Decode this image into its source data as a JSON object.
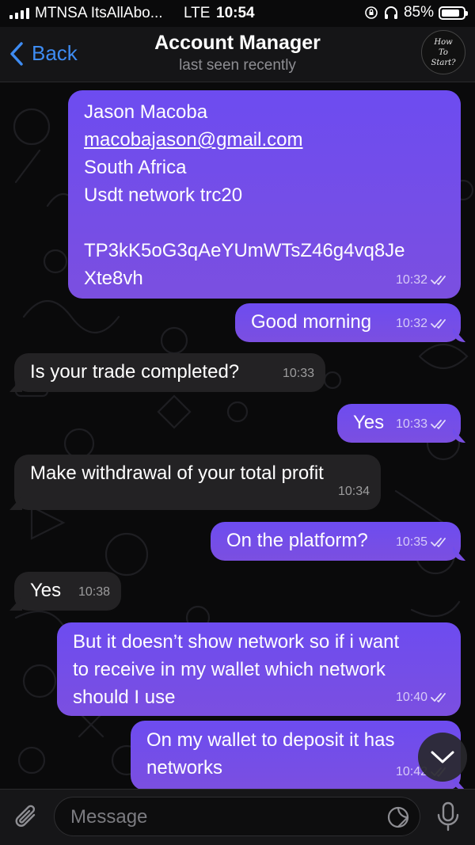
{
  "status_bar": {
    "carrier": "MTNSA ItsAllAbo...",
    "network": "LTE",
    "time": "10:54",
    "battery_percent": "85%",
    "battery_level": 0.85,
    "icons": [
      "signal-icon",
      "orientation-lock-icon",
      "headphones-icon",
      "battery-icon"
    ]
  },
  "header": {
    "back_label": "Back",
    "title": "Account Manager",
    "subtitle": "last seen recently",
    "avatar_text": [
      "How",
      "To",
      "Start?"
    ]
  },
  "messages": [
    {
      "direction": "outgoing",
      "lines": [
        "Jason Macoba",
        "macobajason@gmail.com",
        "South Africa",
        "Usdt network trc20",
        "",
        "TP3kK5oG3qAeYUmWTsZ46g4vq8Je",
        "Xte8vh"
      ],
      "time": "10:32",
      "read": true
    },
    {
      "direction": "outgoing",
      "text": "Good morning",
      "time": "10:32",
      "read": true
    },
    {
      "direction": "incoming",
      "text": "Is your trade completed?",
      "time": "10:33"
    },
    {
      "direction": "outgoing",
      "text": "Yes",
      "time": "10:33",
      "read": true
    },
    {
      "direction": "incoming",
      "text": "Make withdrawal of your total profit",
      "time": "10:34"
    },
    {
      "direction": "outgoing",
      "text": "On the platform?",
      "time": "10:35",
      "read": true
    },
    {
      "direction": "incoming",
      "text": "Yes",
      "time": "10:38"
    },
    {
      "direction": "outgoing",
      "lines": [
        "But it doesn’t show network so if i want",
        "to receive in my wallet which network",
        "should I use"
      ],
      "time": "10:40",
      "read": true
    },
    {
      "direction": "outgoing",
      "lines": [
        "On my wallet to deposit it has",
        "networks"
      ],
      "time": "10:42",
      "read": true
    }
  ],
  "input": {
    "placeholder": "Message"
  },
  "colors": {
    "accent": "#3e8cf3",
    "outgoing_bubble": "#6d4cf0",
    "incoming_bubble": "#232224",
    "background": "#0a0a0b"
  }
}
